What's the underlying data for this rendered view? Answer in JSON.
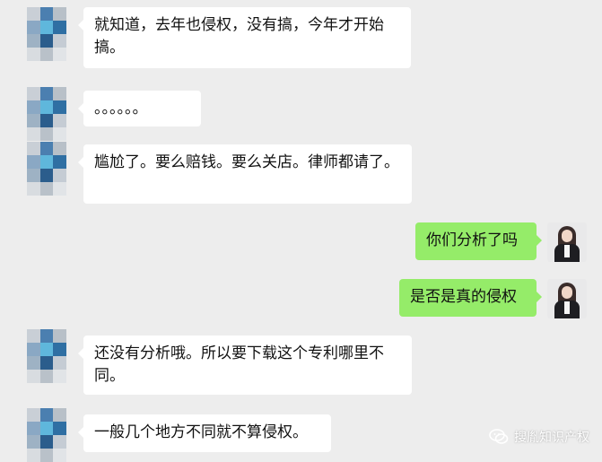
{
  "chat": {
    "messages": [
      {
        "side": "other",
        "text": "就知道，去年也侵权，没有搞，今年才开始搞。"
      },
      {
        "side": "other",
        "text": "。。。。。。"
      },
      {
        "side": "other",
        "text": "尴尬了。要么赔钱。要么关店。律师都请了。"
      },
      {
        "side": "self",
        "text": "你们分析了吗"
      },
      {
        "side": "self",
        "text": "是否是真的侵权"
      },
      {
        "side": "other",
        "text": "还没有分析哦。所以要下载这个专利哪里不同。"
      },
      {
        "side": "other",
        "text": "一般几个地方不同就不算侵权。"
      }
    ]
  },
  "watermark": {
    "text": "搜胤知识产权"
  },
  "colors": {
    "self_bubble": "#95ec69",
    "other_bubble": "#ffffff",
    "background": "#ededed"
  }
}
